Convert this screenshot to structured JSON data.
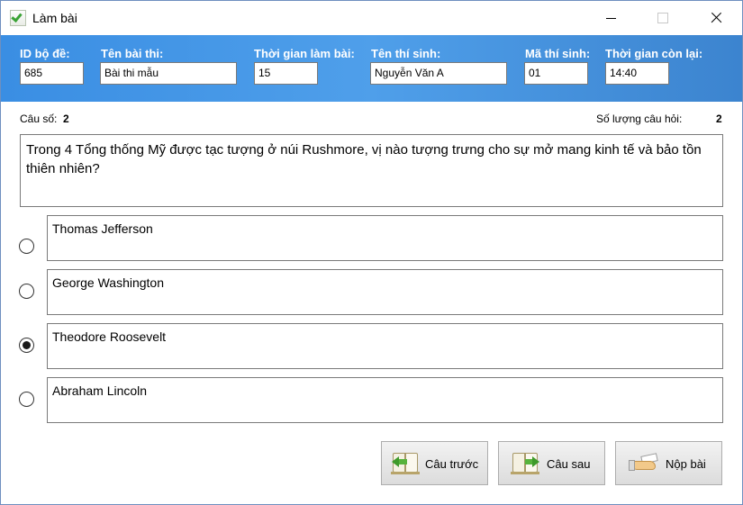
{
  "window": {
    "title": "Làm bài"
  },
  "header": {
    "fields": [
      {
        "label": "ID bộ đề:",
        "value": "685"
      },
      {
        "label": "Tên bài thi:",
        "value": "Bài thi mẫu"
      },
      {
        "label": "Thời gian làm bài:",
        "value": "15"
      },
      {
        "label": "Tên thí sinh:",
        "value": "Nguyễn Văn A"
      },
      {
        "label": "Mã thí sinh:",
        "value": "01"
      },
      {
        "label": "Thời gian còn lại:",
        "value": "14:40"
      }
    ]
  },
  "question": {
    "number_label": "Câu số:",
    "number": "2",
    "count_label": "Số lượng câu hỏi:",
    "count": "2",
    "text": "Trong 4 Tổng thống Mỹ được tạc tượng ở núi Rushmore, vị nào tượng trưng cho sự mở mang kinh tế và bảo tồn thiên nhiên?"
  },
  "answers": [
    {
      "text": "Thomas Jefferson",
      "selected": false
    },
    {
      "text": "George Washington",
      "selected": false
    },
    {
      "text": "Theodore Roosevelt",
      "selected": true
    },
    {
      "text": "Abraham Lincoln",
      "selected": false
    }
  ],
  "buttons": {
    "prev": "Câu trước",
    "next": "Câu sau",
    "submit": "Nộp bài"
  }
}
